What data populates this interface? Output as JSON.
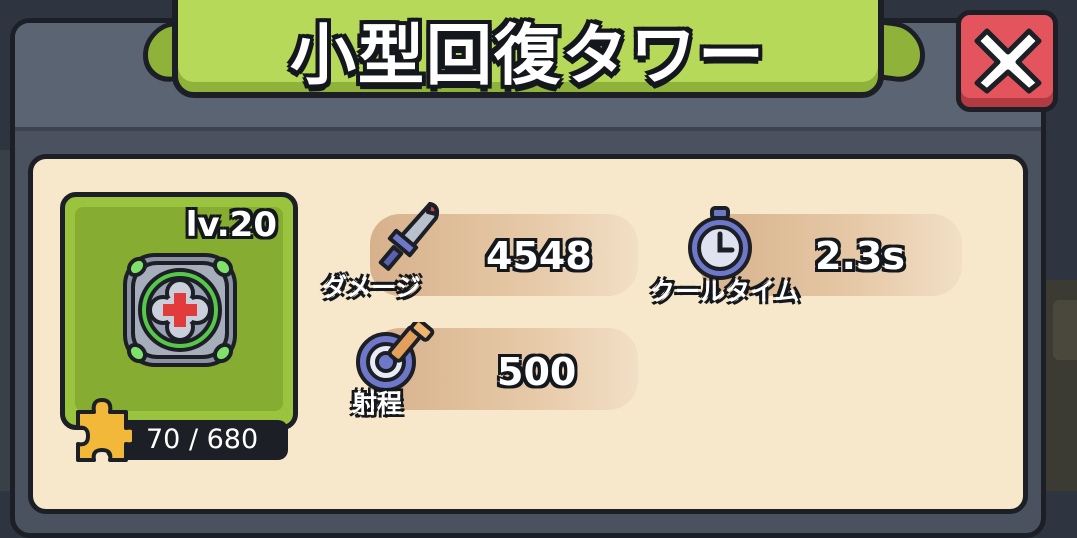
{
  "window": {
    "title": "小型回復タワー",
    "close_icon": "close-x-icon"
  },
  "tower": {
    "level": "lv.20",
    "icon": "heal-tower-icon",
    "shards_text": "70 / 680",
    "shards_icon": "puzzle-piece-icon",
    "shards_progress": 0.103
  },
  "stats": {
    "damage": {
      "label": "ダメージ",
      "value": "4548",
      "icon": "dagger-icon"
    },
    "cooldown": {
      "label": "クールタイム",
      "value": "2.3s",
      "icon": "stopwatch-icon"
    },
    "range": {
      "label": "射程",
      "value": "500",
      "icon": "target-icon"
    }
  },
  "colors": {
    "banner": "#b7d95a",
    "card": "#9bc43e",
    "close": "#e4545c",
    "panel": "#f7e8cc"
  }
}
